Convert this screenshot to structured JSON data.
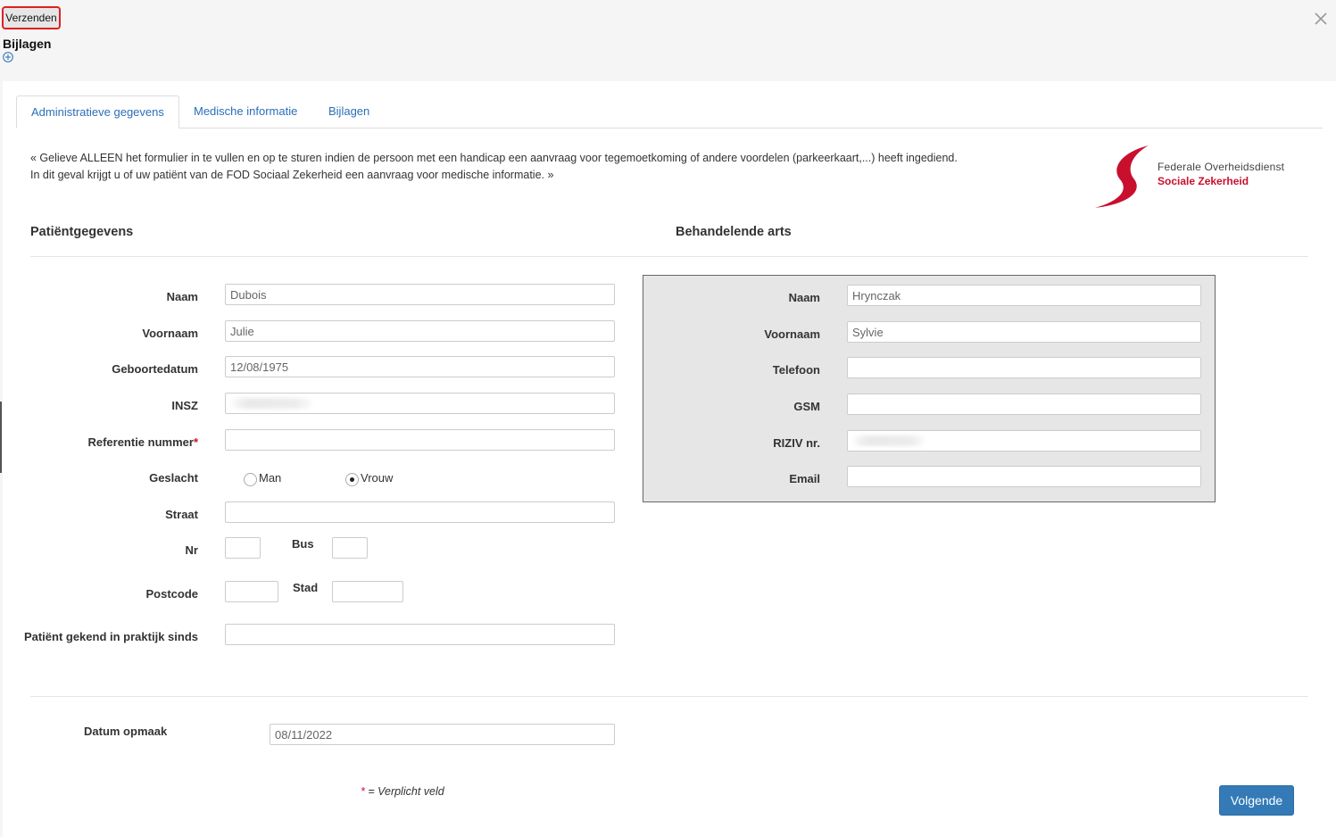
{
  "toolbar": {
    "send_label": "Verzenden"
  },
  "attachments": {
    "title": "Bijlagen"
  },
  "tabs": [
    {
      "label": "Administratieve gegevens",
      "active": true
    },
    {
      "label": "Medische informatie",
      "active": false
    },
    {
      "label": "Bijlagen",
      "active": false
    }
  ],
  "notice": "« Gelieve ALLEEN het formulier in te vullen en op te sturen indien de persoon met een handicap een aanvraag voor tegemoetkoming of andere voordelen (parkeerkaart,...) heeft ingediend. In dit geval krijgt u of uw patiënt van de FOD Sociaal Zekerheid een aanvraag voor medische informatie. »",
  "logo": {
    "line1": "Federale Overheidsdienst",
    "line2": "Sociale Zekerheid",
    "color": "#c8102e"
  },
  "patient": {
    "title": "Patiëntgegevens",
    "name_label": "Naam",
    "name_value": "Dubois",
    "firstname_label": "Voornaam",
    "firstname_value": "Julie",
    "birthdate_label": "Geboortedatum",
    "birthdate_value": "12/08/1975",
    "insz_label": "INSZ",
    "reference_label": "Referentie nummer",
    "required_mark": "*",
    "gender_label": "Geslacht",
    "gender_man": "Man",
    "gender_woman": "Vrouw",
    "gender_selected": "Vrouw",
    "street_label": "Straat",
    "nr_label": "Nr",
    "bus_label": "Bus",
    "postcode_label": "Postcode",
    "city_label": "Stad",
    "known_since_label": "Patiënt gekend in praktijk sinds"
  },
  "doctor": {
    "title": "Behandelende arts",
    "name_label": "Naam",
    "name_value": "Hrynczak",
    "firstname_label": "Voornaam",
    "firstname_value": "Sylvie",
    "phone_label": "Telefoon",
    "gsm_label": "GSM",
    "riziv_label": "RIZIV nr.",
    "email_label": "Email"
  },
  "date": {
    "label": "Datum opmaak",
    "value": "08/11/2022"
  },
  "legend": {
    "mark": "*",
    "text": " = Verplicht veld"
  },
  "footer": {
    "next_label": "Volgende"
  },
  "colors": {
    "accent": "#337ab7",
    "required": "#c8102e",
    "highlight": "#e02020"
  }
}
